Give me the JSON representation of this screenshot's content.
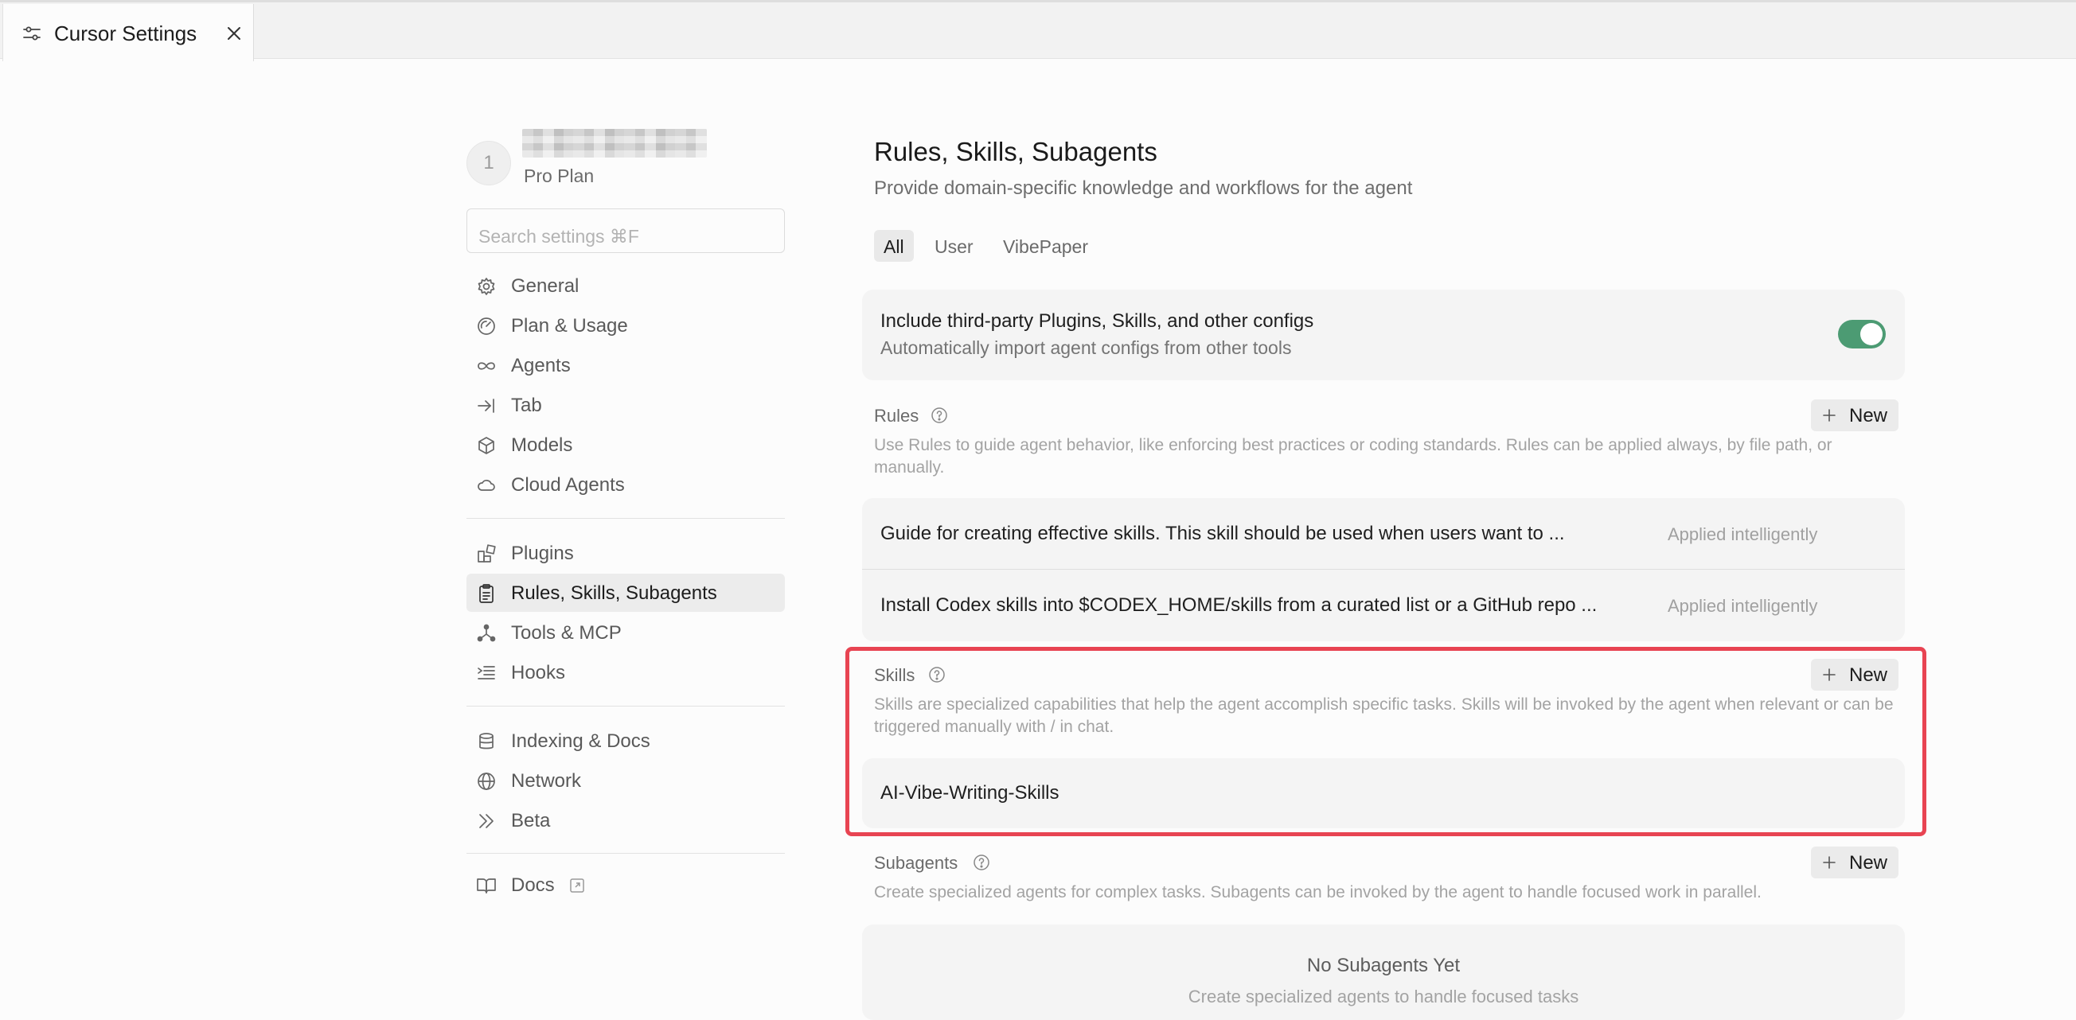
{
  "tab": {
    "title": "Cursor Settings",
    "icon": "sliders-icon",
    "close_icon": "close-icon"
  },
  "profile": {
    "avatar_initial": "1",
    "plan": "Pro Plan"
  },
  "search": {
    "placeholder": "Search settings ⌘F"
  },
  "sidebar": {
    "groups": [
      [
        {
          "label": "General",
          "icon": "gear-icon"
        },
        {
          "label": "Plan & Usage",
          "icon": "gauge-icon"
        },
        {
          "label": "Agents",
          "icon": "infinity-icon"
        },
        {
          "label": "Tab",
          "icon": "arrow-to-line-icon"
        },
        {
          "label": "Models",
          "icon": "cube-icon"
        },
        {
          "label": "Cloud Agents",
          "icon": "cloud-icon"
        }
      ],
      [
        {
          "label": "Plugins",
          "icon": "blocks-icon"
        },
        {
          "label": "Rules, Skills, Subagents",
          "icon": "clipboard-icon",
          "active": true
        },
        {
          "label": "Tools & MCP",
          "icon": "network-nodes-icon"
        },
        {
          "label": "Hooks",
          "icon": "list-indent-icon"
        }
      ],
      [
        {
          "label": "Indexing & Docs",
          "icon": "database-icon"
        },
        {
          "label": "Network",
          "icon": "globe-icon"
        },
        {
          "label": "Beta",
          "icon": "double-chevron-icon"
        }
      ],
      [
        {
          "label": "Docs",
          "icon": "book-icon",
          "external_icon": "external-link-icon"
        }
      ]
    ]
  },
  "main": {
    "title": "Rules, Skills, Subagents",
    "subtitle": "Provide domain-specific knowledge and workflows for the agent",
    "filters": [
      {
        "label": "All",
        "active": true
      },
      {
        "label": "User",
        "active": false
      },
      {
        "label": "VibePaper",
        "active": false
      }
    ],
    "third_party": {
      "title": "Include third-party Plugins, Skills, and other configs",
      "description": "Automatically import agent configs from other tools",
      "enabled": true
    },
    "rules": {
      "heading": "Rules",
      "description": "Use Rules to guide agent behavior, like enforcing best practices or coding standards. Rules can be applied always, by file path, or manually.",
      "new_label": "New",
      "items": [
        {
          "text": "Guide for creating effective skills. This skill should be used when users want to ...",
          "status": "Applied intelligently"
        },
        {
          "text": "Install Codex skills into $CODEX_HOME/skills from a curated list or a GitHub repo ...",
          "status": "Applied intelligently"
        }
      ]
    },
    "skills": {
      "heading": "Skills",
      "description": "Skills are specialized capabilities that help the agent accomplish specific tasks. Skills will be invoked by the agent when relevant or can be triggered manually with / in chat.",
      "new_label": "New",
      "items": [
        {
          "text": "AI-Vibe-Writing-Skills"
        }
      ]
    },
    "subagents": {
      "heading": "Subagents",
      "description": "Create specialized agents for complex tasks. Subagents can be invoked by the agent to handle focused work in parallel.",
      "new_label": "New",
      "empty_title": "No Subagents Yet",
      "empty_subtitle": "Create specialized agents to handle focused tasks"
    }
  },
  "colors": {
    "toggle_on": "#4c9b73",
    "highlight_border": "#e84452"
  }
}
